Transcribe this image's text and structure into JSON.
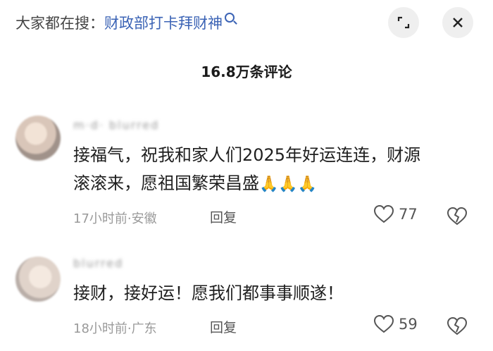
{
  "header": {
    "search_prefix": "大家都在搜：",
    "search_topic": "财政部打卡拜财神",
    "comment_count": "16.8万条评论"
  },
  "comments": [
    {
      "username": "m·d· blurred",
      "text_line1": "接福气，祝我和家人们2025年好运连连，财源",
      "text_line2": "滚滚来，愿祖国繁荣昌盛",
      "emojis": "🙏🙏🙏",
      "time_location": "17小时前·安徽",
      "reply_label": "回复",
      "likes": "77"
    },
    {
      "username": "blurred",
      "text_line1": "接财，接好运！愿我们都事事顺遂！",
      "time_location": "18小时前·广东",
      "reply_label": "回复",
      "likes": "59"
    }
  ]
}
